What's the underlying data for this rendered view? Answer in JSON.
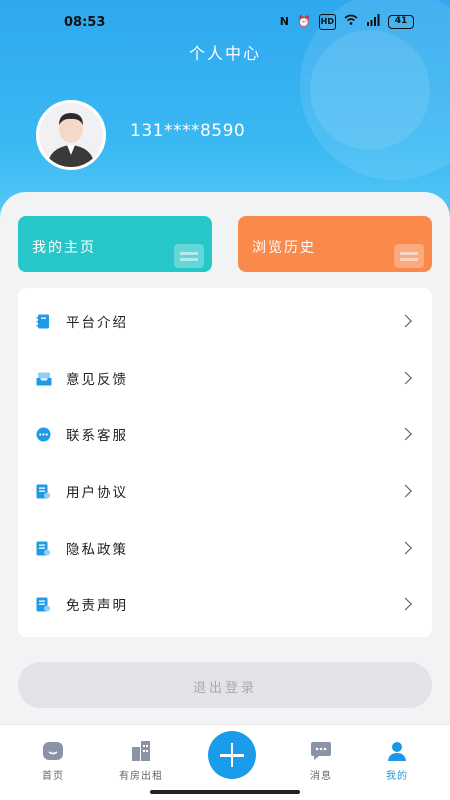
{
  "status_bar": {
    "time": "08:53",
    "battery": "41",
    "hd": "HD"
  },
  "header": {
    "title": "个人中心",
    "phone": "131****8590"
  },
  "cards": {
    "home": "我的主页",
    "history": "浏览历史"
  },
  "menu": {
    "items": [
      {
        "label": "平台介绍",
        "icon": "book-icon"
      },
      {
        "label": "意见反馈",
        "icon": "inbox-icon"
      },
      {
        "label": "联系客服",
        "icon": "chat-icon"
      },
      {
        "label": "用户协议",
        "icon": "document-icon"
      },
      {
        "label": "隐私政策",
        "icon": "document-icon"
      },
      {
        "label": "免责声明",
        "icon": "document-icon"
      }
    ]
  },
  "logout": "退出登录",
  "tabbar": {
    "home": "首页",
    "rent": "有房出租",
    "messages": "消息",
    "mine": "我的"
  },
  "colors": {
    "primary": "#1a9cea",
    "card_home": "#27c6c8",
    "card_history": "#f98a4c"
  }
}
